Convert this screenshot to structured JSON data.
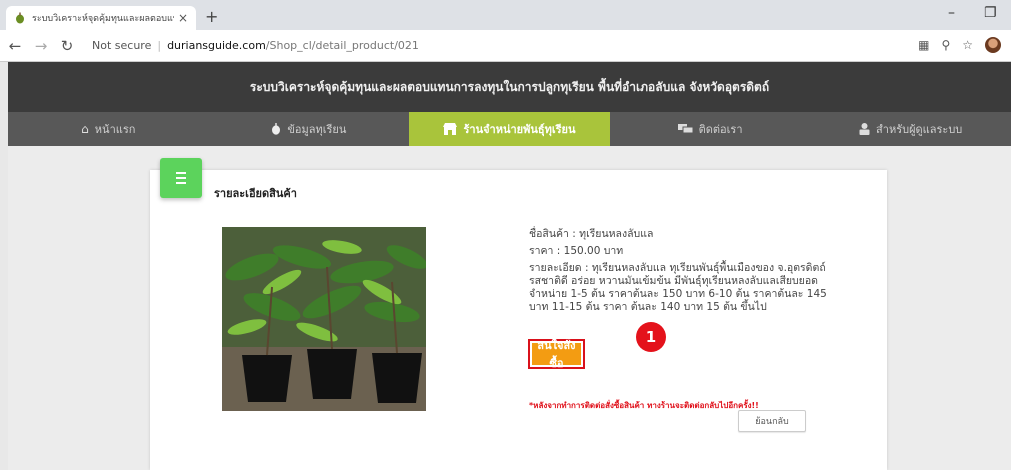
{
  "browser": {
    "tab_title": "ระบบวิเคราะห์จุดคุ้มทุนและผลตอบแทน",
    "tab_close": "×",
    "new_tab": "+",
    "url_security": "Not secure",
    "url_host": "duriansguide.com",
    "url_path": "/Shop_cl/detail_product/021",
    "minimize": "–",
    "restore": "❐"
  },
  "site": {
    "header_title": "ระบบวิเคราะห์จุดคุ้มทุนและผลตอบแทนการลงทุนในการปลูกทุเรียน พื้นที่อำเภอลับแล จังหวัดอุตรดิตถ์",
    "nav": [
      {
        "label": "หน้าแรก",
        "icon": "home-icon",
        "active": false
      },
      {
        "label": "ข้อมูลทุเรียน",
        "icon": "durian-icon",
        "active": false
      },
      {
        "label": "ร้านจำหน่ายพันธุ์ทุเรียน",
        "icon": "shop-icon",
        "active": true
      },
      {
        "label": "ติดต่อเรา",
        "icon": "chat-icon",
        "active": false
      },
      {
        "label": "สำหรับผู้ดูแลระบบ",
        "icon": "admin-icon",
        "active": false
      }
    ],
    "active_color": "#a9c43b"
  },
  "card": {
    "title": "รายละเอียดสินค้า",
    "product_name": "ชื่อสินค้า : ทุเรียนหลงลับแล",
    "price": "ราคา : 150.00 บาท",
    "description": "รายละเอียด : ทุเรียนหลงลับแล ทุเรียนพันธุ์พื้นเมืองของ จ.อุตรดิตถ์ รสชาติดี อร่อย หวานมันเข้มข้น มีพันธุ์ทุเรียนหลงลับแลเสียบยอดจำหน่าย 1-5 ต้น ราคาต้นละ 150 บาท 6-10 ต้น ราคาต้นละ 145 บาท 11-15 ต้น ราคา ต้นละ 140 บาท 15 ต้น ขึ้นไป",
    "order_button": "สนใจสั่งซื้อ",
    "marker": "1",
    "note": "*หลังจากทำการติดต่อสั่งซื้อสินค้า ทางร้านจะติดต่อกลับไปอีกครั้ง!!",
    "back_button": "ย้อนกลับ"
  }
}
